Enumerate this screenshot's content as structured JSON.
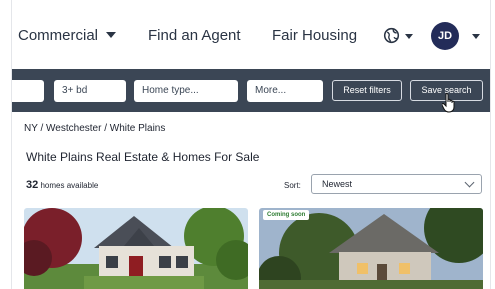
{
  "nav": {
    "commercial_label": "Commercial",
    "find_agent_label": "Find an Agent",
    "fair_housing_label": "Fair Housing",
    "avatar_initials": "JD"
  },
  "filters": {
    "beds_value": "3+ bd",
    "home_type_placeholder": "Home type...",
    "more_label": "More...",
    "reset_label": "Reset filters",
    "save_label": "Save search"
  },
  "breadcrumb": "NY / Westchester / White Plains",
  "page_title": "White Plains Real Estate & Homes For Sale",
  "results": {
    "count": "32",
    "count_suffix": "homes available"
  },
  "sort": {
    "label": "Sort:",
    "selected": "Newest"
  },
  "listings": [
    {
      "badge": ""
    },
    {
      "badge": "Coming soon"
    }
  ],
  "colors": {
    "filter_bar": "#3b4655",
    "avatar": "#232c59",
    "badge_text": "#2e7d32"
  }
}
